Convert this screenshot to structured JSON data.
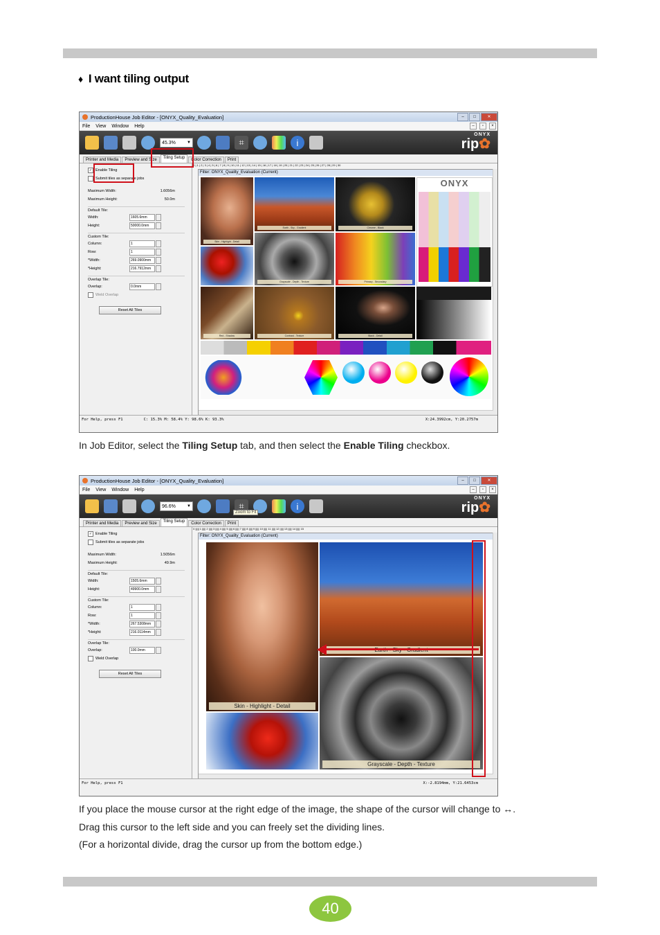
{
  "heading": {
    "bullet": "♦",
    "title": "I want tiling output"
  },
  "paragraph1": {
    "pre": "In Job Editor, select the ",
    "b1": "Tiling Setup",
    "mid": " tab, and then select the ",
    "b2": "Enable Tiling",
    "post": " checkbox."
  },
  "paragraph2": {
    "line1": "If you place the mouse cursor at the right edge of the image, the shape of the cursor will change to ↔.",
    "line2": "Drag this cursor to the left side and you can freely set the dividing lines.",
    "line3": "(For a horizontal divide, drag the cursor up from the bottom edge.)"
  },
  "page_number": "40",
  "app": {
    "title": "ProductionHouse Job Editor - [ONYX_Quality_Evaluation]",
    "menu": [
      "File",
      "View",
      "Window",
      "Help"
    ],
    "logo_top": "ONYX",
    "logo_main": "rip",
    "tabs": [
      "Printer and Media",
      "Preview and Size",
      "Tiling Setup",
      "Color Correction",
      "Print"
    ],
    "filter": "Filter: ONYX_Quality_Evaluation (Current)",
    "status_left": "For Help, press F1",
    "enable_tiling": "Enable Tiling",
    "submit_tiles": "Submit tiles as separate jobs",
    "max_width_label": "Maximum Width:",
    "max_height_label": "Maximum Height:",
    "default_tile": "Default Tile:",
    "width_label": "Width:",
    "height_label": "Height:",
    "custom_tile": "Custom Tile:",
    "column_label": "Column:",
    "row_label": "Row:",
    "cwidth_label": "*Width:",
    "cheight_label": "*Height:",
    "overlap_tile": "Overlap Tile:",
    "overlap_label": "Overlap:",
    "weld_overlap": "Weld Overlap",
    "reset_all": "Reset All Tiles",
    "onyx_brand": "ONYX"
  },
  "shot1": {
    "zoom": "45.3%",
    "status_cmyk": "C: 15.3% M: 58.4% Y: 98.6% K: 93.3%",
    "status_xy": "X:24.3992cm, Y:20.2757m",
    "max_width": "1.6056m",
    "max_height": "50.0m",
    "width": "1605.6mm",
    "height": "50000.0mm",
    "column": "1",
    "row": "1",
    "cwidth": "269.0900mm",
    "cheight": "216.7912mm",
    "overlap": "0.0mm",
    "captions": [
      "Skin - Highlight - Detail",
      "Earth - Sky - Gradient",
      "Chrome - Black",
      "Grayscale - Depth - Texture",
      "Primary - Secondary",
      "Red - Shadow",
      "Contrast - Texture",
      "Black - Detail"
    ]
  },
  "shot2": {
    "zoom": "96.6%",
    "tooltip": "Zoom to Fit",
    "status_xy": "X:-2.8194mm, Y:21.6453cm",
    "max_width": "1.5056m",
    "max_height": "49.9m",
    "width": "1505.6mm",
    "height": "49900.0mm",
    "column": "1",
    "row": "1",
    "cwidth": "267.5308mm",
    "cheight": "216.0114mm",
    "overlap": "100.0mm",
    "cap_skin": "Skin - Highlight - Detail",
    "cap_earth": "Earth - Sky - Gradient",
    "cap_gray": "Grayscale - Depth - Texture"
  },
  "colors": {
    "accent_red": "#d0101a",
    "page_badge": "#8dc63f",
    "band": "#c8c8c8"
  }
}
